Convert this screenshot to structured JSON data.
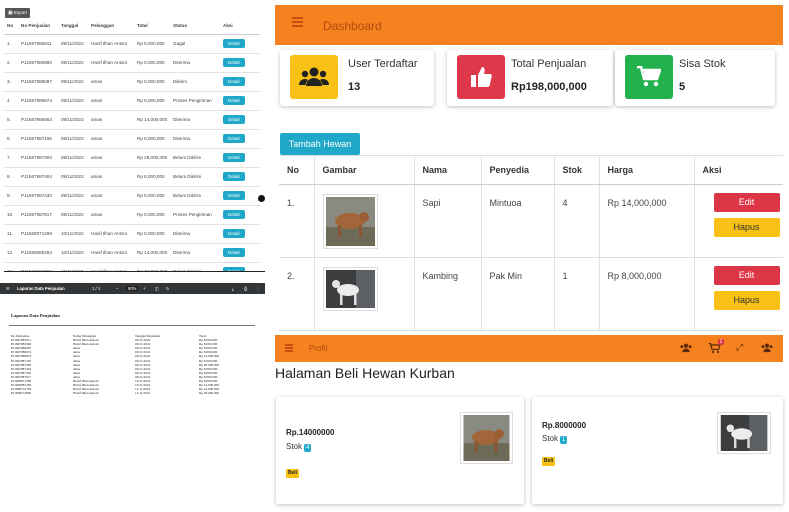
{
  "colors": {
    "accent_orange": "#f5821f",
    "accent_teal": "#20a8c8",
    "danger": "#dc3545",
    "warning": "#f7c115",
    "stat_yellow": "#f7c115",
    "stat_red": "#e0384b",
    "stat_green": "#22b14c"
  },
  "sales": {
    "export_label": "Export",
    "headers": [
      "No",
      "No Penjualan",
      "Tanggal",
      "Pelanggan",
      "Total",
      "Status",
      "Aksi"
    ],
    "detail_label": "Detail",
    "rows": [
      [
        "1.",
        "PJ1667985911",
        "09/11/2022",
        "Hanif Ilhan Antoni",
        "Rp 8,000,000",
        "Gagal"
      ],
      [
        "2.",
        "PJ1667985960",
        "09/11/2022",
        "Hanif Ilhan Antoni",
        "Rp 8,000,000",
        "Diterima"
      ],
      [
        "3.",
        "PJ1667986097",
        "09/11/2022",
        "amas",
        "Rp 8,000,000",
        "Dikirim"
      ],
      [
        "4.",
        "PJ1667986674",
        "09/11/2022",
        "amas",
        "Rp 8,000,000",
        "Proses Pengiriman"
      ],
      [
        "5.",
        "PJ1667986853",
        "09/11/2022",
        "amas",
        "Rp 14,000,000",
        "Diterima"
      ],
      [
        "6.",
        "PJ1667987195",
        "09/11/2022",
        "amas",
        "Rp 8,000,000",
        "Diterima"
      ],
      [
        "7.",
        "PJ1667987300",
        "09/11/2022",
        "amas",
        "Rp 28,000,000",
        "Belum Dikirim"
      ],
      [
        "8.",
        "PJ1667987404",
        "09/11/2022",
        "amas",
        "Rp 8,000,000",
        "Belum Dikirim"
      ],
      [
        "9.",
        "PJ1667987430",
        "09/11/2022",
        "amas",
        "Rp 8,000,000",
        "Belum Dikirim"
      ],
      [
        "10.",
        "PJ1667987617",
        "09/11/2022",
        "amas",
        "Rp 8,000,000",
        "Proses Pengiriman"
      ],
      [
        "11.",
        "PJ1668071298",
        "10/11/2022",
        "Hanif Ilhan Antoni",
        "Rp 8,000,000",
        "Diterima"
      ],
      [
        "12.",
        "PJ1668085284",
        "10/11/2022",
        "Hanif Ilhan Antoni",
        "Rp 14,000,000",
        "Diterima"
      ],
      [
        "13.",
        "PJ1668152769",
        "11/11/2022",
        "Hanif Ilhan Antoni",
        "Rp 42,000,000",
        "Belum Dikirim"
      ]
    ]
  },
  "pdf": {
    "toolbar_title": "Laporan Data Penjualan",
    "page_indicator": "1 / 1",
    "zoom": "80%",
    "doc_title": "Laporan Data Penjualan",
    "headers": [
      "No Penjualan",
      "Nama Pelanggan",
      "Tanggal Penjualan",
      "Total"
    ],
    "rows": [
      [
        "PJ1667985911",
        "Hanif Ilhan Antoni",
        "09/11/2022",
        "Rp 8.000.000"
      ],
      [
        "PJ1667985960",
        "Hanif Ilhan Antoni",
        "09/11/2022",
        "Rp 8.000.000"
      ],
      [
        "PJ1667986097",
        "amas",
        "09/11/2022",
        "Rp 8.000.000"
      ],
      [
        "PJ1667986674",
        "amas",
        "09/11/2022",
        "Rp 8.000.000"
      ],
      [
        "PJ1667986853",
        "amas",
        "09/11/2022",
        "Rp 14.000.000"
      ],
      [
        "PJ1667987195",
        "amas",
        "09/11/2022",
        "Rp 8.000.000"
      ],
      [
        "PJ1667987300",
        "amas",
        "09/11/2022",
        "Rp 28.000.000"
      ],
      [
        "PJ1667987404",
        "amas",
        "09/11/2022",
        "Rp 8.000.000"
      ],
      [
        "PJ1667987430",
        "amas",
        "09/11/2022",
        "Rp 8.000.000"
      ],
      [
        "PJ1667987617",
        "amas",
        "09/11/2022",
        "Rp 8.000.000"
      ],
      [
        "PJ1668071298",
        "Hanif Ilhan Antoni",
        "10/11/2022",
        "Rp 8.000.000"
      ],
      [
        "PJ1668085284",
        "Hanif Ilhan Antoni",
        "10/11/2022",
        "Rp 14.000.000"
      ],
      [
        "PJ1668152769",
        "Hanif Ilhan Antoni",
        "11/11/2022",
        "Rp 42.000.000"
      ],
      [
        "PJ1668152800",
        "Hanif Ilhan Antoni",
        "11/11/2022",
        "Rp 28.000.000"
      ]
    ]
  },
  "dashboard": {
    "title": "Dashboard",
    "stats": [
      {
        "label": "User Terdaftar",
        "value": "13",
        "icon": "users-icon"
      },
      {
        "label": "Total Penjualan",
        "value": "Rp198,000,000",
        "icon": "thumbs-up-icon"
      },
      {
        "label": "Sisa Stok",
        "value": "5",
        "icon": "cart-icon"
      }
    ],
    "add_button": "Tambah Hewan",
    "table_headers": [
      "No",
      "Gambar",
      "Nama",
      "Penyedia",
      "Stok",
      "Harga",
      "Aksi"
    ],
    "animals": [
      {
        "no": "1.",
        "nama": "Sapi",
        "penyedia": "Mintuoa",
        "stok": "4",
        "harga": "Rp 14,000,000",
        "image": "cow-photo"
      },
      {
        "no": "2.",
        "nama": "Kambing",
        "penyedia": "Pak Min",
        "stok": "1",
        "harga": "Rp 8,000,000",
        "image": "goat-photo"
      }
    ],
    "edit_label": "Edit",
    "hapus_label": "Hapus"
  },
  "profil": {
    "title": "Profil",
    "heading": "Halaman Beli Hewan Kurban",
    "notif_count": "1",
    "stock_label": "Stok",
    "buy_label": "Beli",
    "products": [
      {
        "price": "Rp.14000000",
        "stock": "4",
        "image": "cow-photo"
      },
      {
        "price": "Rp.8000000",
        "stock": "1",
        "image": "goat-photo"
      }
    ]
  }
}
